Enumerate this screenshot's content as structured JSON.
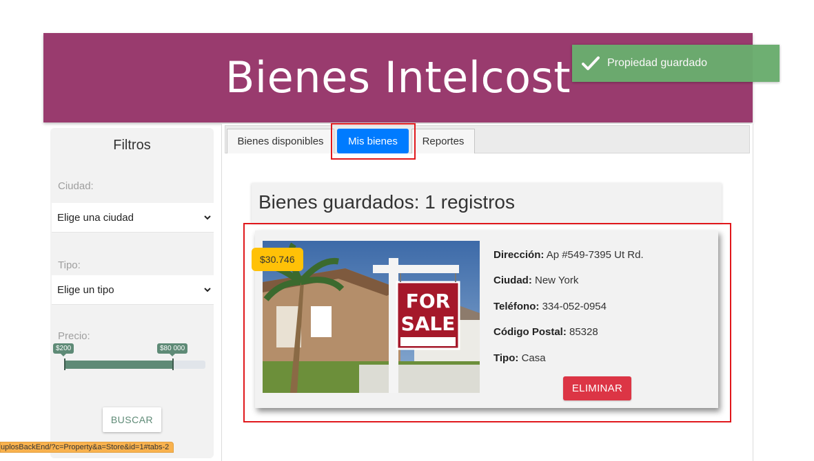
{
  "header": {
    "title": "Bienes Intelcost"
  },
  "toast": {
    "message": "Propiedad guardado"
  },
  "sidebar": {
    "title": "Filtros",
    "city_label": "Ciudad:",
    "city_value": "Elige una ciudad",
    "type_label": "Tipo:",
    "type_value": "Elige un tipo",
    "price_label": "Precio:",
    "price_min": "$200",
    "price_max": "$80 000",
    "search_button": "BUSCAR"
  },
  "tabs": [
    {
      "label": "Bienes disponibles",
      "active": false
    },
    {
      "label": "Mis bienes",
      "active": true
    },
    {
      "label": "Reportes",
      "active": false
    }
  ],
  "saved": {
    "heading": "Bienes guardados: 1 registros"
  },
  "property": {
    "price": "$30.746",
    "image_sign_line1": "FOR",
    "image_sign_line2": "SALE",
    "address_label": "Dirección:",
    "address": "Ap #549-7395 Ut Rd.",
    "city_label": "Ciudad:",
    "city": "New York",
    "phone_label": "Teléfono:",
    "phone": "334-052-0954",
    "zip_label": "Código Postal:",
    "zip": "85328",
    "type_label": "Tipo:",
    "type": "Casa",
    "delete_button": "ELIMINAR"
  },
  "status_url": "uplosBackEnd/?c=Property&a=Store&id=1#tabs-2",
  "colors": {
    "header": "#993b6e",
    "accent": "#007bff",
    "danger": "#dc3545",
    "price_badge": "#ffc107",
    "toast": "#6aad6e",
    "highlight": "#e0171b"
  }
}
